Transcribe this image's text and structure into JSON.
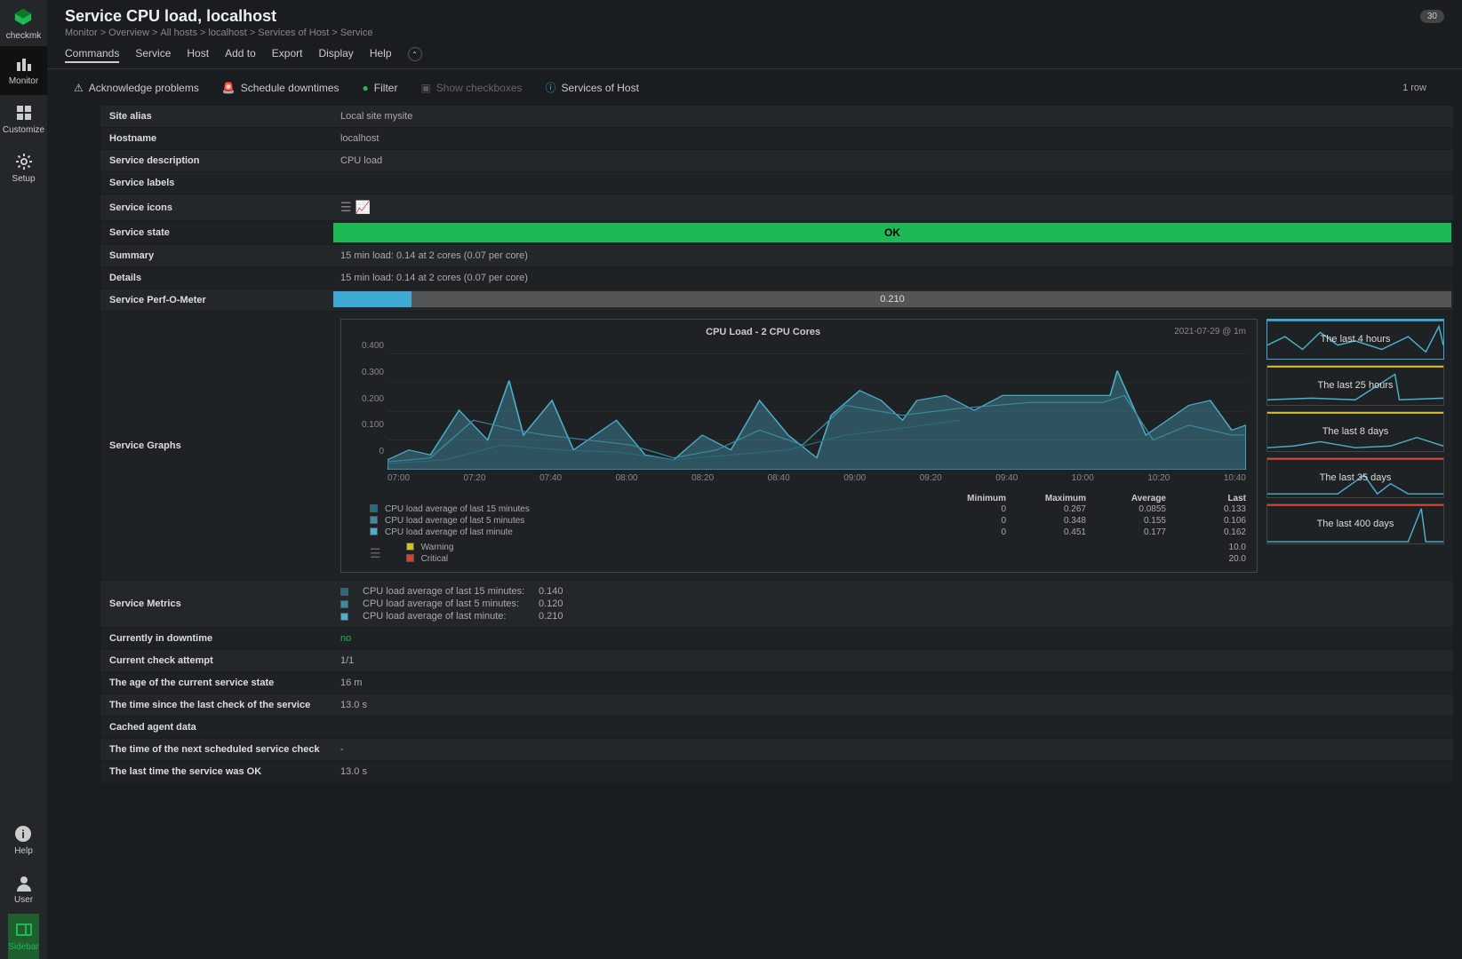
{
  "logo_text": "checkmk",
  "side_nav": {
    "monitor": "Monitor",
    "customize": "Customize",
    "setup": "Setup",
    "help": "Help",
    "user": "User",
    "sidebar": "Sidebar"
  },
  "page_title": "Service CPU load, localhost",
  "refresh_badge": "30",
  "breadcrumb": [
    "Monitor",
    "Overview",
    "All hosts",
    "localhost",
    "Services of Host",
    "Service"
  ],
  "menus": [
    "Commands",
    "Service",
    "Host",
    "Add to",
    "Export",
    "Display",
    "Help"
  ],
  "toolbar": {
    "acknowledge": "Acknowledge problems",
    "schedule": "Schedule downtimes",
    "filter": "Filter",
    "show_checkboxes": "Show checkboxes",
    "services_of_host": "Services of Host"
  },
  "row_count": "1 row",
  "rows": {
    "site_alias": {
      "label": "Site alias",
      "value": "Local site mysite"
    },
    "hostname": {
      "label": "Hostname",
      "value": "localhost"
    },
    "service_desc": {
      "label": "Service description",
      "value": "CPU load"
    },
    "service_labels": {
      "label": "Service labels",
      "value": ""
    },
    "service_icons": {
      "label": "Service icons"
    },
    "service_state": {
      "label": "Service state",
      "value": "OK"
    },
    "summary": {
      "label": "Summary",
      "value": "15 min load: 0.14 at 2 cores (0.07 per core)"
    },
    "details": {
      "label": "Details",
      "value": "15 min load: 0.14 at 2 cores (0.07 per core)"
    },
    "perfometer": {
      "label": "Service Perf-O-Meter",
      "value": "0.210",
      "fill_pct": 7
    },
    "graphs": {
      "label": "Service Graphs"
    },
    "metrics": {
      "label": "Service Metrics"
    },
    "downtime": {
      "label": "Currently in downtime",
      "value": "no"
    },
    "check_attempt": {
      "label": "Current check attempt",
      "value": "1/1"
    },
    "age_state": {
      "label": "The age of the current service state",
      "value": "16 m"
    },
    "time_since_check": {
      "label": "The time since the last check of the service",
      "value": "13.0 s"
    },
    "cached_agent": {
      "label": "Cached agent data",
      "value": ""
    },
    "next_check": {
      "label": "The time of the next scheduled service check",
      "value": "-"
    },
    "last_ok": {
      "label": "The last time the service was OK",
      "value": "13.0 s"
    }
  },
  "chart_data": {
    "type": "line",
    "title": "CPU Load - 2 CPU Cores",
    "timestamp": "2021-07-29 @ 1m",
    "ylim": [
      0,
      0.45
    ],
    "y_ticks": [
      "0.400",
      "0.300",
      "0.200",
      "0.100",
      "0"
    ],
    "x_ticks": [
      "07:00",
      "07:20",
      "07:40",
      "08:00",
      "08:20",
      "08:40",
      "09:00",
      "09:20",
      "09:40",
      "10:00",
      "10:20",
      "10:40"
    ],
    "legend_cols": [
      "Minimum",
      "Maximum",
      "Average",
      "Last"
    ],
    "series": [
      {
        "name": "CPU load average of last 15 minutes",
        "color": "#2a6a80",
        "min": "0",
        "max": "0.267",
        "avg": "0.0855",
        "last": "0.133"
      },
      {
        "name": "CPU load average of last 5 minutes",
        "color": "#3a8aa0",
        "min": "0",
        "max": "0.348",
        "avg": "0.155",
        "last": "0.106"
      },
      {
        "name": "CPU load average of last minute",
        "color": "#4ab0cc",
        "min": "0",
        "max": "0.451",
        "avg": "0.177",
        "last": "0.162"
      }
    ],
    "thresholds": [
      {
        "name": "Warning",
        "color": "#d4c020",
        "value": "10.0"
      },
      {
        "name": "Critical",
        "color": "#d84030",
        "value": "20.0"
      }
    ]
  },
  "thumbnails": [
    {
      "label": "The last 4 hours",
      "active": true
    },
    {
      "label": "The last 25 hours"
    },
    {
      "label": "The last 8 days"
    },
    {
      "label": "The last 35 days"
    },
    {
      "label": "The last 400 days"
    }
  ],
  "metrics": [
    {
      "name": "CPU load average of last 15 minutes:",
      "value": "0.140",
      "color": "#2a6a80"
    },
    {
      "name": "CPU load average of last 5 minutes:",
      "value": "0.120",
      "color": "#3a8aa0"
    },
    {
      "name": "CPU load average of last minute:",
      "value": "0.210",
      "color": "#4ab0cc"
    }
  ]
}
